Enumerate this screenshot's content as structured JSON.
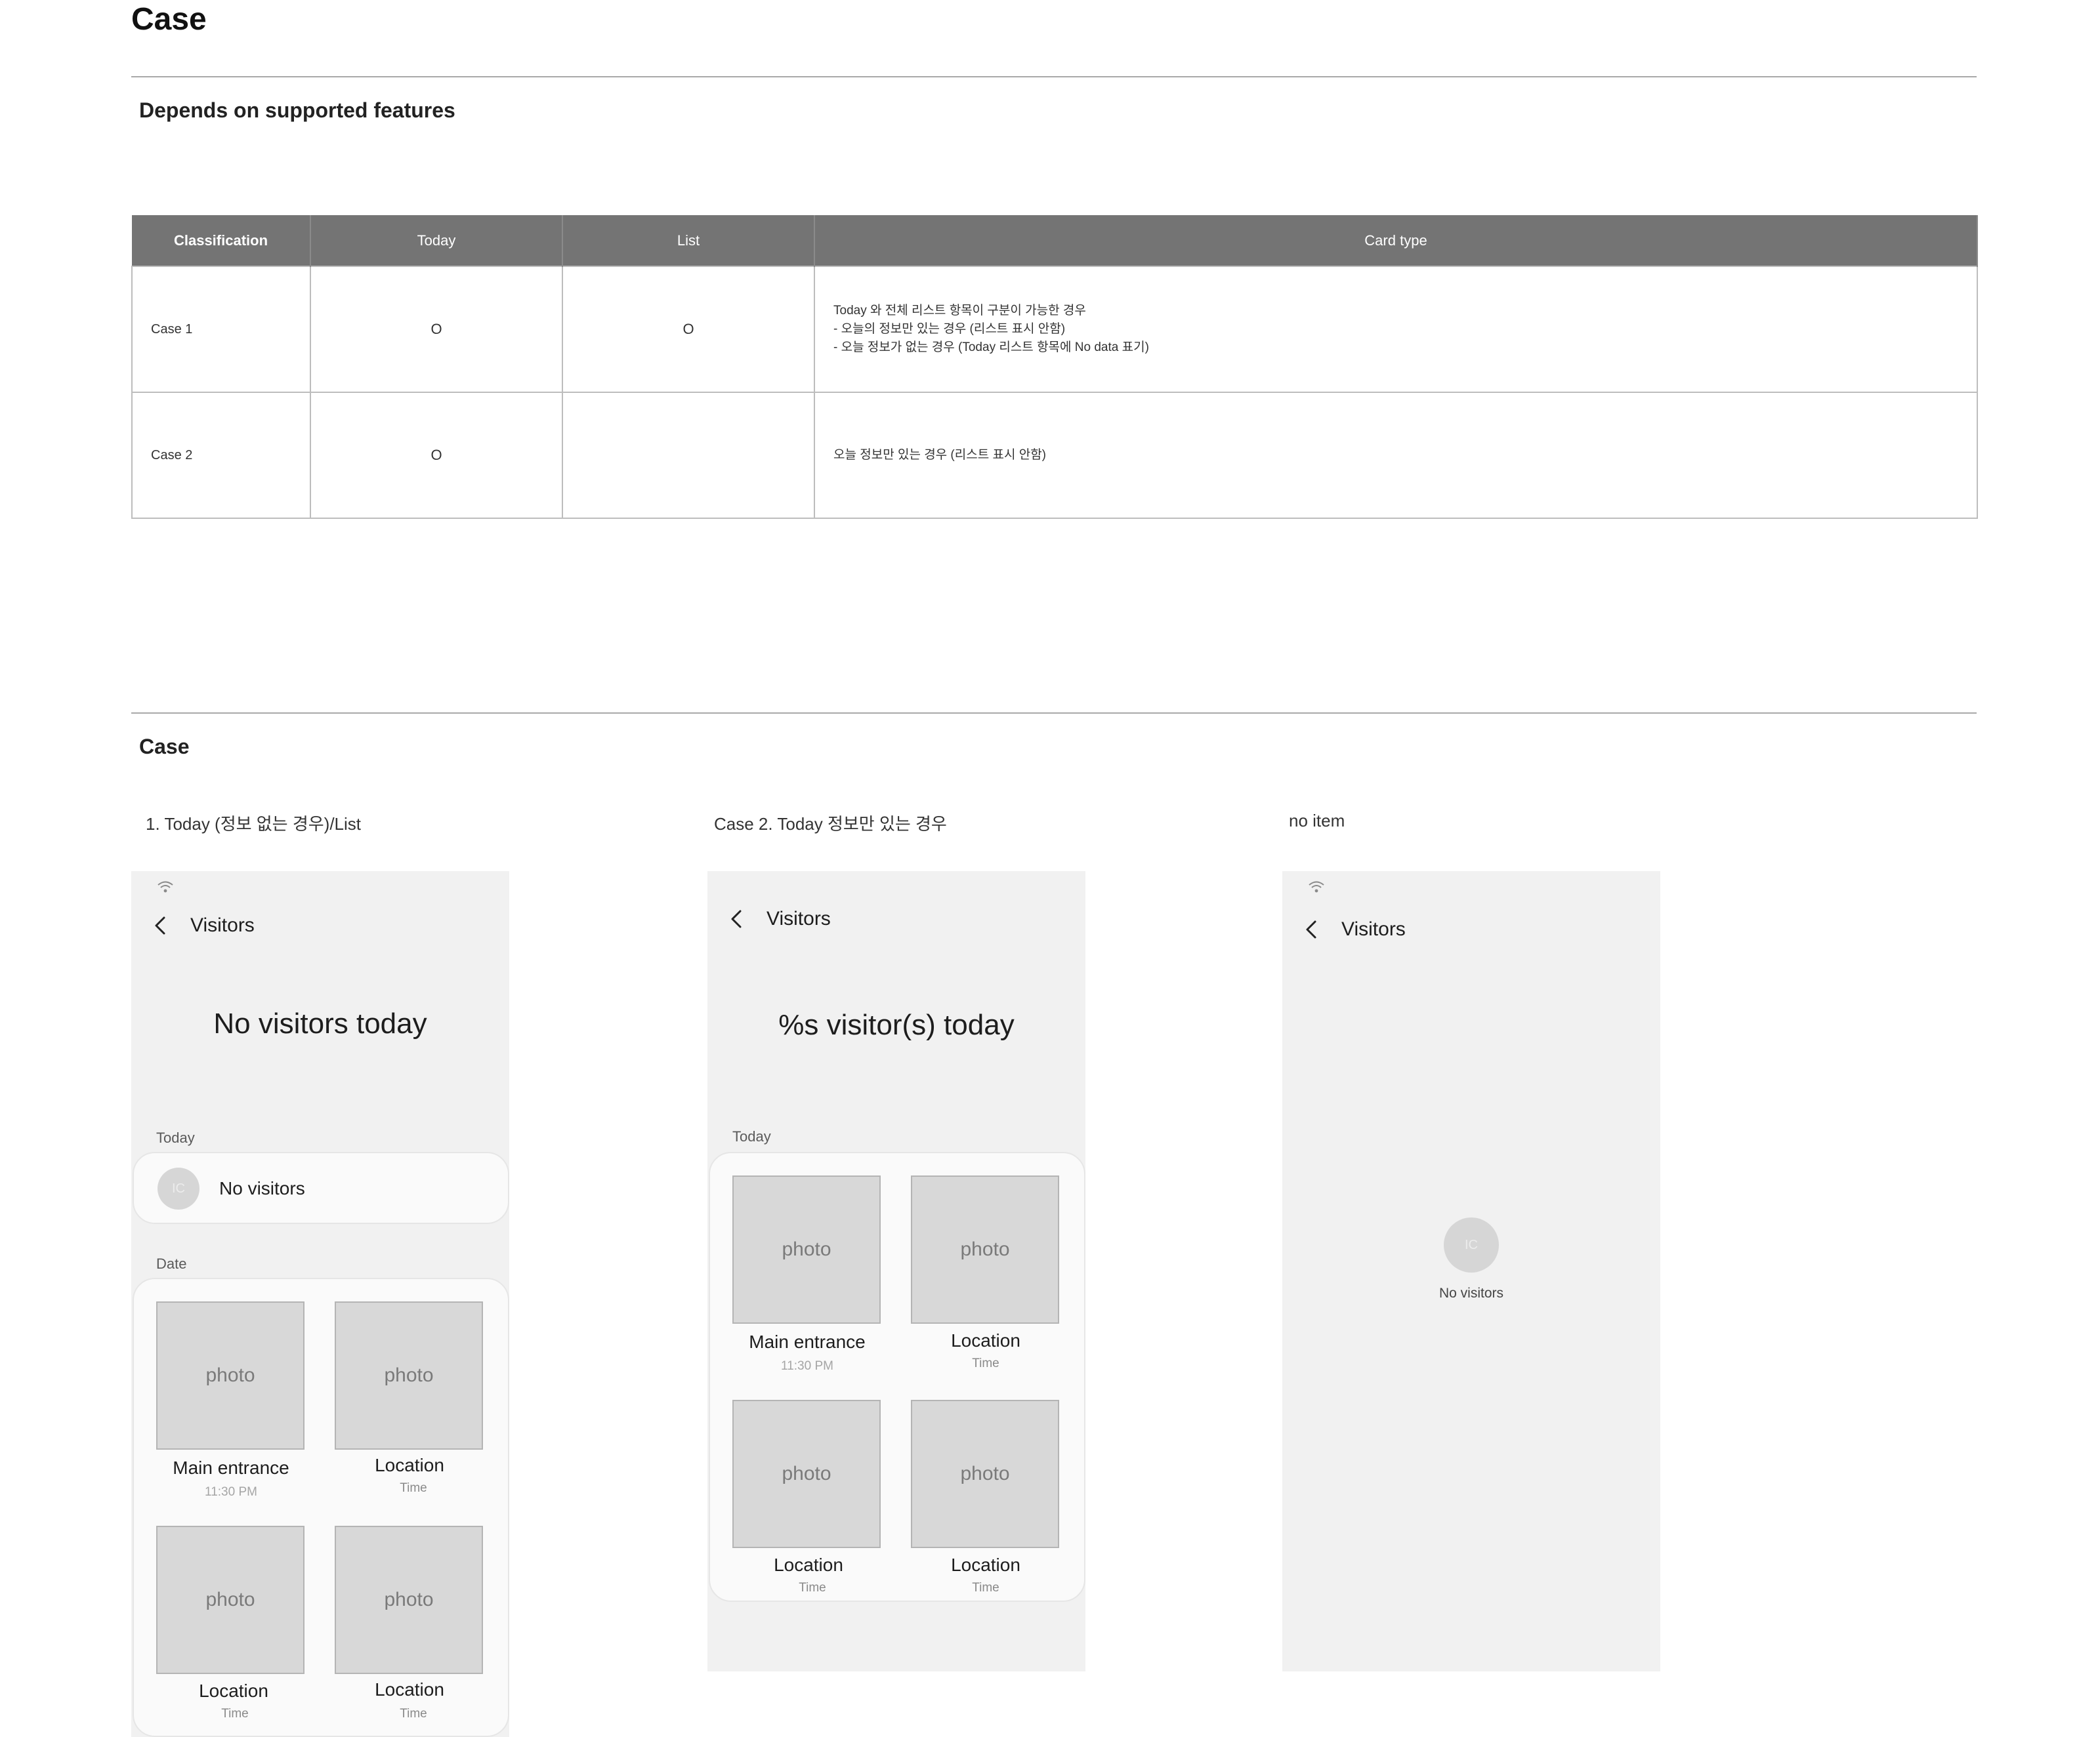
{
  "page": {
    "title": "Case",
    "section1_title": "Depends on supported features",
    "section2_title": "Case"
  },
  "table": {
    "headers": [
      "Classification",
      "Today",
      "List",
      "Card type"
    ],
    "rows": [
      {
        "classification": "Case 1",
        "today": "O",
        "list": "O",
        "card_lines": [
          "Today 와 전체 리스트 항목이 구분이 가능한 경우",
          "- 오늘의 정보만 있는 경우 (리스트 표시 안함)",
          "- 오늘 정보가 없는 경우 (Today 리스트 항목에 No data 표기)"
        ]
      },
      {
        "classification": "Case 2",
        "today": "O",
        "list": "",
        "card_lines": [
          "오늘 정보만 있는 경우 (리스트 표시 안함)"
        ]
      }
    ]
  },
  "cases": [
    {
      "label": "1. Today (정보 없는 경우)/List",
      "app_title": "Visitors",
      "headline": "No visitors today",
      "today_label": "Today",
      "avatar_text": "IC",
      "no_visitors": "No visitors",
      "date_label": "Date",
      "tiles": [
        {
          "photo": "photo",
          "title": "Main entrance",
          "time": "11:30 PM"
        },
        {
          "photo": "photo",
          "title": "Location",
          "time": "Time"
        },
        {
          "photo": "photo",
          "title": "Location",
          "time": "Time"
        },
        {
          "photo": "photo",
          "title": "Location",
          "time": "Time"
        }
      ]
    },
    {
      "label": "Case 2. Today 정보만 있는 경우",
      "app_title": "Visitors",
      "headline": "%s visitor(s) today",
      "today_label": "Today",
      "tiles": [
        {
          "photo": "photo",
          "title": "Main entrance",
          "time": "11:30 PM"
        },
        {
          "photo": "photo",
          "title": "Location",
          "time": "Time"
        },
        {
          "photo": "photo",
          "title": "Location",
          "time": "Time"
        },
        {
          "photo": "photo",
          "title": "Location",
          "time": "Time"
        }
      ]
    },
    {
      "label": "no item",
      "app_title": "Visitors",
      "avatar_text": "IC",
      "empty_text": "No visitors"
    }
  ],
  "icons": {
    "status": "wifi-icon",
    "back": "chevron-left-icon"
  },
  "colors": {
    "table_header": "#747474",
    "phone_bg": "#f1f1f1",
    "photo_placeholder": "#d8d8d8"
  }
}
